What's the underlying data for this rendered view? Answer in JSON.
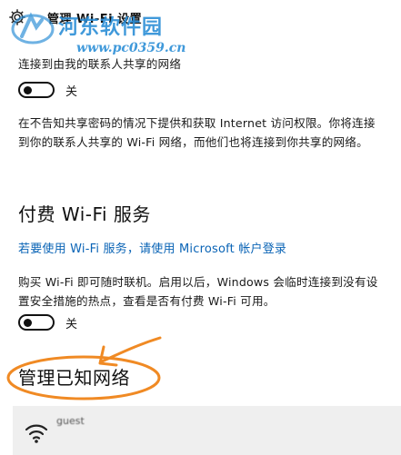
{
  "window": {
    "title": "管理 Wi-Fi 设置",
    "icon": "gear-icon"
  },
  "watermark": {
    "title": "河东软件园",
    "url": "www.pc0359.cn"
  },
  "contacts_share": {
    "label": "连接到由我的联系人共享的网络",
    "toggle_state": "关",
    "description": "在不告知共享密码的情况下提供和获取 Internet 访问权限。你将连接到你的联系人共享的 Wi-Fi 网络，而他们也将连接到你共享的网络。"
  },
  "paid_wifi": {
    "heading": "付费 Wi-Fi 服务",
    "link": "若要使用 Wi-Fi 服务，请使用 Microsoft 帐户登录",
    "description": "购买 Wi-Fi 即可随时联机。启用以后，Windows 会临时连接到没有设置安全措施的热点，查看是否有付费 Wi-Fi 可用。",
    "toggle_state": "关"
  },
  "known_networks": {
    "heading": "管理已知网络",
    "items": [
      {
        "name": "guest",
        "icon": "wifi-icon"
      }
    ]
  },
  "colors": {
    "link": "#0a64b6",
    "annotation": "#f08a24",
    "watermark": "#2c8ed6",
    "network_row_bg": "#efefef"
  }
}
